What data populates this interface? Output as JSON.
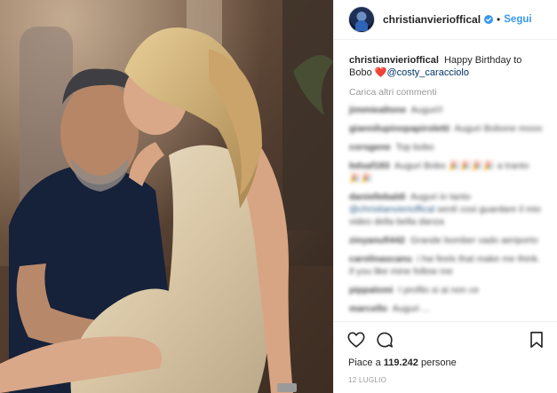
{
  "post": {
    "username": "christianvierioffical",
    "verified": true,
    "separator": "•",
    "follow_label": "Segui",
    "caption_user": "christianvierioffical",
    "caption_text": "Happy Birthday to Bobo",
    "caption_emoji": "❤️",
    "caption_mention": "@costy_caracciolo",
    "load_more_label": "Carica altri commenti",
    "comments": [
      {
        "user": "jimmiealtone",
        "text": "Auguri!!"
      },
      {
        "user": "giannilupinopapiroletti",
        "text": "Auguri Bobone mooo"
      },
      {
        "user": "corsgene",
        "text": "Top bobo"
      },
      {
        "user": "bdsaf183",
        "text": "Auguri Bobo 🎉🎉🎉🎉 a tranto 🎉🎉"
      },
      {
        "user": "daniellebaldi",
        "text": "Auguri in tanto",
        "mention": "@christianvierioffical",
        "tail": "sentì cosi guardare il mio video della bella danza"
      },
      {
        "user": "zioyanufi442",
        "text": "Grande bomber vado aeriporto"
      },
      {
        "user": "carolinascanu",
        "text": "i hw feels that make me think. if you like mine follow me"
      },
      {
        "user": "pippalomi",
        "text": "I profilo si ai non ce"
      },
      {
        "user": "marcello",
        "text": "Auguri ..."
      }
    ],
    "likes_prefix": "Piace a",
    "likes_count": "119.242",
    "likes_suffix": "persone",
    "date": "12 luglio"
  },
  "icons": {
    "like": "heart-outline-icon",
    "comment": "speech-bubble-icon",
    "save": "bookmark-outline-icon",
    "verified": "verified-badge-icon"
  },
  "colors": {
    "link": "#3897f0",
    "mention": "#003569",
    "muted": "#999999",
    "text": "#262626",
    "border": "#efefef"
  }
}
